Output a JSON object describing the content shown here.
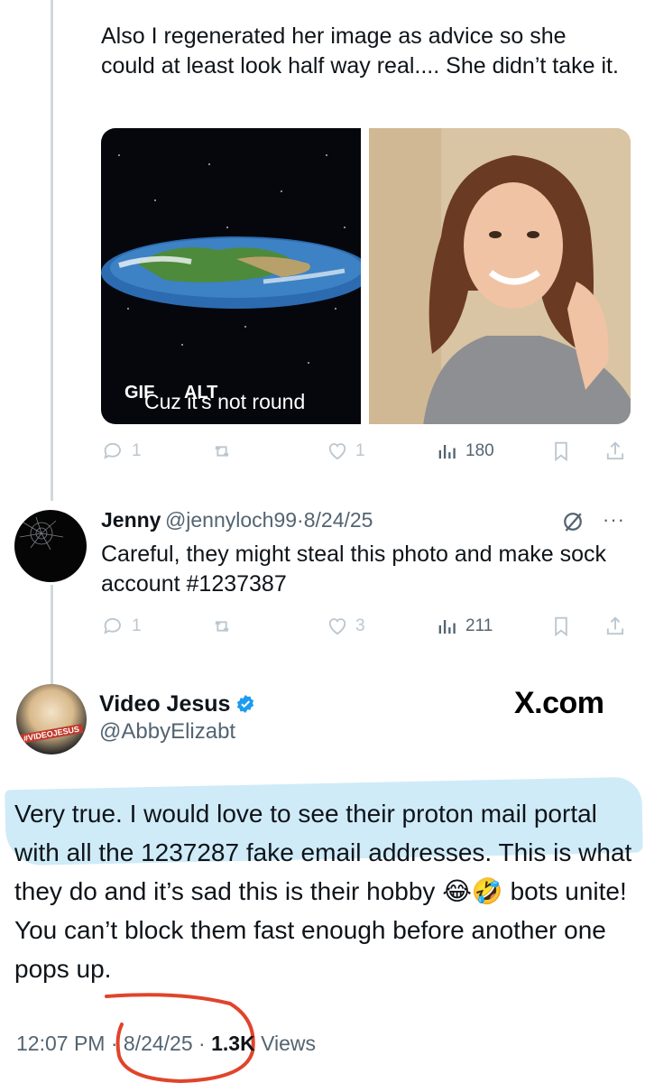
{
  "tweet1": {
    "text": "Also I regenerated her image as advice so she could at least look half way real.... She didn’t take it.",
    "media": {
      "gif_caption": "Cuz it's not round",
      "gif_badge": "GIF",
      "alt_badge": "ALT"
    },
    "actions": {
      "replies": "1",
      "reposts": "",
      "likes": "1",
      "views": "180"
    }
  },
  "tweet2": {
    "name": "Jenny",
    "handle": "@jennyloch99",
    "date": "8/24/25",
    "separator": "·",
    "text": "Careful, they might steal this photo and make sock account #1237387",
    "more": "···",
    "actions": {
      "replies": "1",
      "reposts": "",
      "likes": "3",
      "views": "211"
    }
  },
  "tweet3": {
    "name": "Video Jesus",
    "handle": "@AbbyElizabt",
    "avatar_text": "#VIDEOJESUS",
    "watermark": "X.com",
    "text": "Very true. I would love to see their proton mail portal with all the 1237287 fake email addresses. This is what they do and it’s sad this is their hobby 😂🤣 bots unite! You can’t block them fast enough before another one pops up.",
    "time": "12:07 PM",
    "date": "8/24/25",
    "views_count": "1.3K",
    "views_label": "Views",
    "sep": "·"
  },
  "colors": {
    "verified": "#1d9bf0",
    "highlight": "#94d2f0",
    "annotation": "#e0442b",
    "muted": "#536471"
  }
}
